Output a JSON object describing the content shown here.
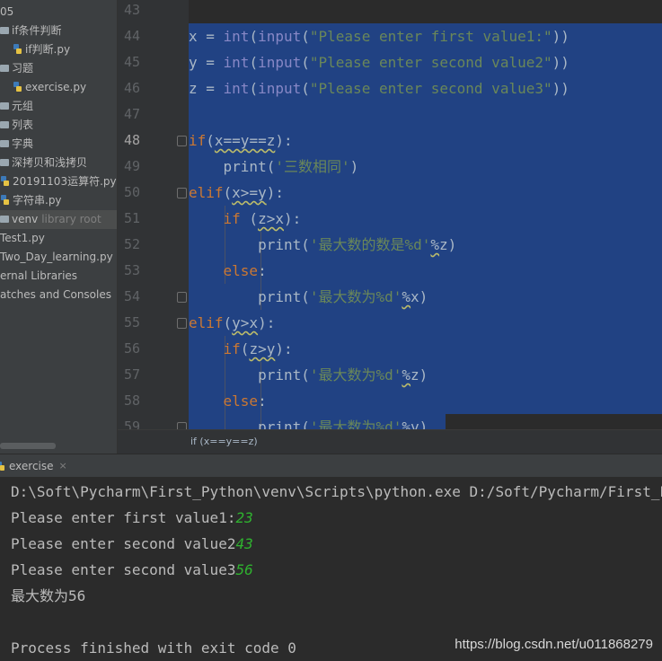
{
  "sidebar": {
    "items": [
      {
        "label": "05",
        "type": "text"
      },
      {
        "label": "if条件判断",
        "type": "folder"
      },
      {
        "label": "if判断.py",
        "type": "python-file"
      },
      {
        "label": "习题",
        "type": "folder"
      },
      {
        "label": "exercise.py",
        "type": "python-file"
      },
      {
        "label": "元组",
        "type": "folder"
      },
      {
        "label": "列表",
        "type": "folder"
      },
      {
        "label": "字典",
        "type": "folder"
      },
      {
        "label": "深拷贝和浅拷贝",
        "type": "folder"
      },
      {
        "label": "20191103运算符.py",
        "type": "python-file"
      },
      {
        "label": "字符串.py",
        "type": "python-file"
      },
      {
        "label": "venv",
        "secondary": "library root",
        "type": "folder",
        "selected": true
      },
      {
        "label": "Test1.py",
        "type": "text"
      },
      {
        "label": "Two_Day_learning.py",
        "type": "text"
      },
      {
        "label": "ernal Libraries",
        "type": "text"
      },
      {
        "label": "atches and Consoles",
        "type": "text"
      }
    ]
  },
  "editor": {
    "line_numbers": [
      "43",
      "44",
      "45",
      "46",
      "47",
      "48",
      "49",
      "50",
      "51",
      "52",
      "53",
      "54",
      "55",
      "56",
      "57",
      "58",
      "59"
    ],
    "current_line": "48",
    "lines": [
      [],
      [
        [
          "var",
          "x = "
        ],
        [
          "fn",
          "int"
        ],
        [
          "var",
          "("
        ],
        [
          "fn",
          "input"
        ],
        [
          "var",
          "("
        ],
        [
          "str",
          "\"Please enter first value1:\""
        ],
        [
          "var",
          "))"
        ]
      ],
      [
        [
          "var",
          "y = "
        ],
        [
          "fn",
          "int"
        ],
        [
          "var",
          "("
        ],
        [
          "fn",
          "input"
        ],
        [
          "var",
          "("
        ],
        [
          "str",
          "\"Please enter second value2\""
        ],
        [
          "var",
          "))"
        ]
      ],
      [
        [
          "var",
          "z = "
        ],
        [
          "fn",
          "int"
        ],
        [
          "var",
          "("
        ],
        [
          "fn",
          "input"
        ],
        [
          "var",
          "("
        ],
        [
          "str",
          "\"Please enter second value3\""
        ],
        [
          "var",
          "))"
        ]
      ],
      [],
      [
        [
          "kw",
          "if"
        ],
        [
          "var",
          "("
        ],
        [
          "wavy",
          "x==y==z"
        ],
        [
          "var",
          "):"
        ]
      ],
      [
        [
          "var",
          "    print("
        ],
        [
          "str",
          "'三数相同'"
        ],
        [
          "var",
          ")"
        ]
      ],
      [
        [
          "kw",
          "elif"
        ],
        [
          "var",
          "("
        ],
        [
          "wavy",
          "x>=y"
        ],
        [
          "var",
          "):"
        ]
      ],
      [
        [
          "var",
          "    "
        ],
        [
          "kw",
          "if"
        ],
        [
          "var",
          " ("
        ],
        [
          "wavy",
          "z>x"
        ],
        [
          "var",
          "):"
        ]
      ],
      [
        [
          "var",
          "        print("
        ],
        [
          "str",
          "'最大数的数是%d'"
        ],
        [
          "wavy",
          "%"
        ],
        [
          "var",
          "z)"
        ]
      ],
      [
        [
          "var",
          "    "
        ],
        [
          "kw",
          "else"
        ],
        [
          "var",
          ":"
        ]
      ],
      [
        [
          "var",
          "        print("
        ],
        [
          "str",
          "'最大数为%d'"
        ],
        [
          "wavy",
          "%"
        ],
        [
          "var",
          "x)"
        ]
      ],
      [
        [
          "kw",
          "elif"
        ],
        [
          "var",
          "("
        ],
        [
          "wavy",
          "y>x"
        ],
        [
          "var",
          "):"
        ]
      ],
      [
        [
          "var",
          "    "
        ],
        [
          "kw",
          "if"
        ],
        [
          "var",
          "("
        ],
        [
          "wavy",
          "z>y"
        ],
        [
          "var",
          "):"
        ]
      ],
      [
        [
          "var",
          "        print("
        ],
        [
          "str",
          "'最大数为%d'"
        ],
        [
          "wavy",
          "%"
        ],
        [
          "var",
          "z)"
        ]
      ],
      [
        [
          "var",
          "    "
        ],
        [
          "kw",
          "else"
        ],
        [
          "var",
          ":"
        ]
      ],
      [
        [
          "var",
          "        print("
        ],
        [
          "str",
          "'最大数为%d'"
        ],
        [
          "wavy",
          "%"
        ],
        [
          "var",
          "y)"
        ]
      ]
    ],
    "breadcrumb": "if (x==y==z)"
  },
  "run_panel": {
    "tab_label": "exercise",
    "close_glyph": "×",
    "console_lines": [
      [
        [
          "out",
          "D:\\Soft\\Pycharm\\First_Python\\venv\\Scripts\\python.exe D:/Soft/Pycharm/First_Python/"
        ]
      ],
      [
        [
          "out",
          "Please enter first value1:"
        ],
        [
          "in",
          "23"
        ]
      ],
      [
        [
          "out",
          "Please enter second value2"
        ],
        [
          "in",
          "43"
        ]
      ],
      [
        [
          "out",
          "Please enter second value3"
        ],
        [
          "in",
          "56"
        ]
      ],
      [
        [
          "out",
          "最大数为56"
        ]
      ],
      [],
      [
        [
          "out",
          "Process finished with exit code 0"
        ]
      ]
    ]
  },
  "watermark": "https://blog.csdn.net/u011868279",
  "colors": {
    "selection": "#214283",
    "keyword": "#cc7832",
    "builtin": "#8888c6",
    "string": "#6a8759",
    "console_input": "#2fb22f"
  }
}
